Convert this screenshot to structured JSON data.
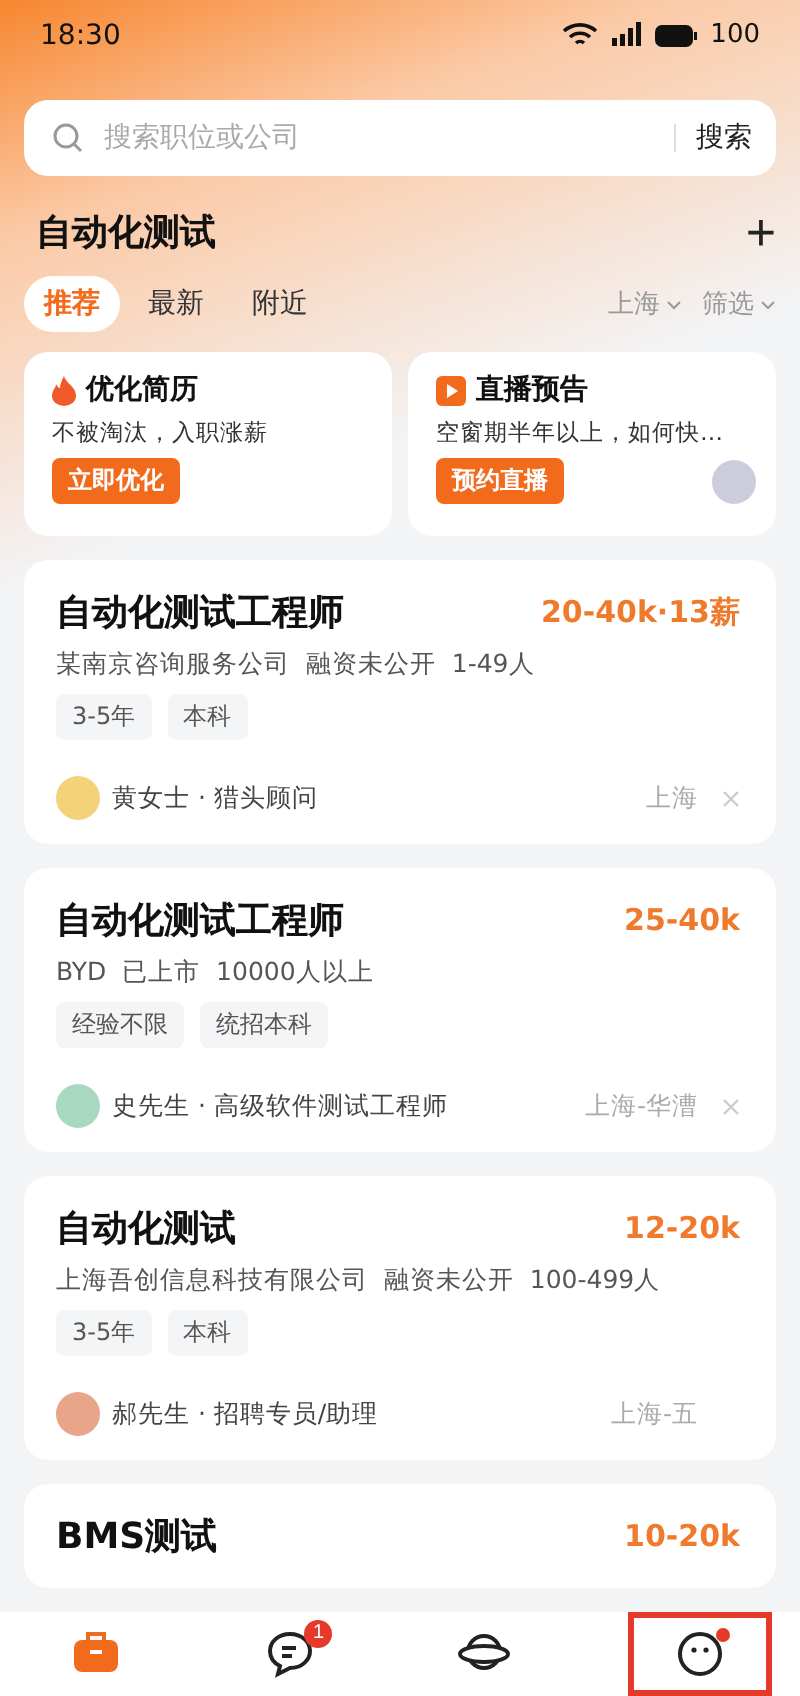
{
  "status_bar": {
    "time": "18:30",
    "battery": "100"
  },
  "search": {
    "placeholder": "搜索职位或公司",
    "button": "搜索"
  },
  "header": {
    "title": "自动化测试",
    "add": "+"
  },
  "tabs": [
    {
      "label": "推荐",
      "selected": true
    },
    {
      "label": "最新",
      "selected": false
    },
    {
      "label": "附近",
      "selected": false
    }
  ],
  "filters": [
    {
      "label": "上海"
    },
    {
      "label": "筛选"
    }
  ],
  "promos": [
    {
      "kind": "resume",
      "title": "优化简历",
      "text": "不被淘汰，入职涨薪",
      "button": "立即优化"
    },
    {
      "kind": "live",
      "title": "直播预告",
      "text": "空窗期半年以上，如何快…",
      "button": "预约直播"
    }
  ],
  "jobs": [
    {
      "title": "自动化测试工程师",
      "salary": "20-40k·13薪",
      "company": [
        "某南京咨询服务公司",
        "融资未公开",
        "1-49人"
      ],
      "tags": [
        "3-5年",
        "本科"
      ],
      "recruiter": "黄女士 · 猎头顾问",
      "location": "上海",
      "closable": true
    },
    {
      "title": "自动化测试工程师",
      "salary": "25-40k",
      "company": [
        "BYD",
        "已上市",
        "10000人以上"
      ],
      "tags": [
        "经验不限",
        "统招本科"
      ],
      "recruiter": "史先生 · 高级软件测试工程师",
      "location": "上海-华漕",
      "closable": true
    },
    {
      "title": "自动化测试",
      "salary": "12-20k",
      "company": [
        "上海吾创信息科技有限公司",
        "融资未公开",
        "100-499人"
      ],
      "tags": [
        "3-5年",
        "本科"
      ],
      "recruiter": "郝先生 · 招聘专员/助理",
      "location": "上海-五"
    },
    {
      "title": "BMS测试",
      "salary": "10-20k"
    }
  ],
  "nav": [
    {
      "kind": "jobs",
      "selected": true
    },
    {
      "kind": "messages",
      "selected": false,
      "badge": "1"
    },
    {
      "kind": "discover",
      "selected": false
    },
    {
      "kind": "me",
      "selected": false,
      "dot": true,
      "highlighted": true
    }
  ]
}
